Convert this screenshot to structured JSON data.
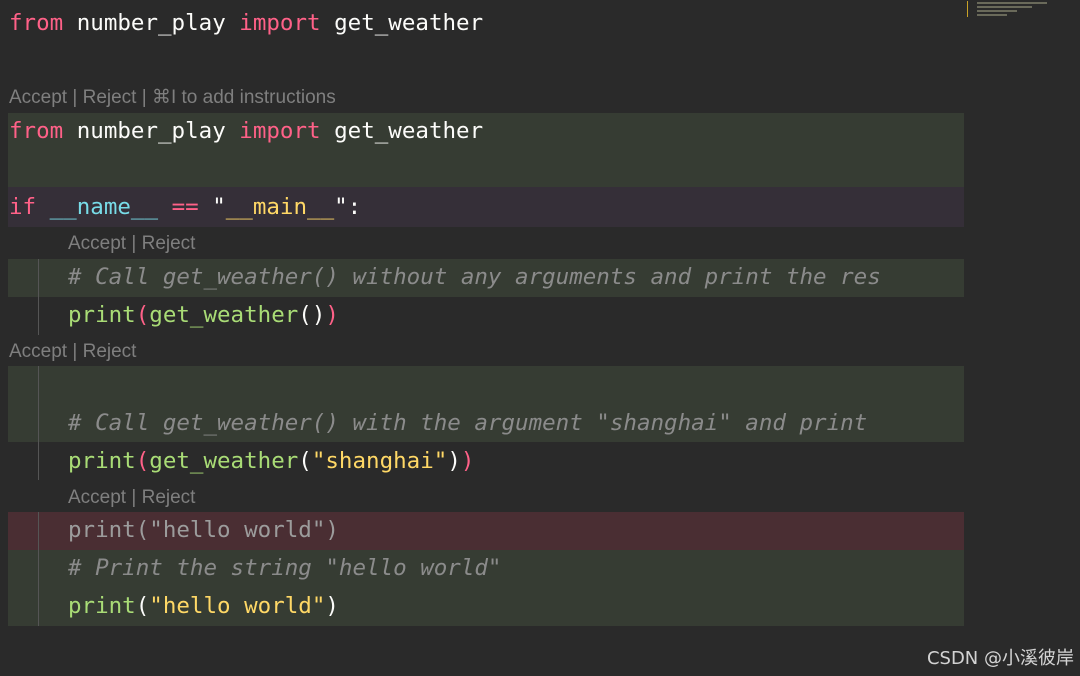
{
  "editor": {
    "line1": {
      "from": "from",
      "module": "number_play",
      "import": "import",
      "name": "get_weather"
    },
    "edit_prompt": {
      "accept": "Accept",
      "sep1": " | ",
      "reject": "Reject",
      "sep2": " | ",
      "instructions": "⌘I to add instructions"
    },
    "line2": {
      "from": "from",
      "module": "number_play",
      "import": "import",
      "name": "get_weather"
    },
    "line_if": {
      "if": "if",
      "dunder": "__name__",
      "eq": "==",
      "quote_open": "\"",
      "main": "__main__",
      "quote_close": "\"",
      "colon": ":"
    },
    "hunk1_prompt": {
      "accept": "Accept",
      "sep": " | ",
      "reject": "Reject"
    },
    "hunk1_comment": "# Call get_weather() without any arguments and print the res",
    "hunk1_print": {
      "print": "print",
      "open": "(",
      "fn": "get_weather",
      "args": "()",
      "close": ")"
    },
    "hunk2_prompt": {
      "accept": "Accept",
      "sep": " | ",
      "reject": "Reject"
    },
    "hunk2_comment": "# Call get_weather() with the argument \"shanghai\" and print",
    "hunk2_print": {
      "print": "print",
      "open": "(",
      "fn": "get_weather",
      "open2": "(",
      "str": "\"shanghai\"",
      "close2": ")",
      "close": ")"
    },
    "hunk3_prompt": {
      "accept": "Accept",
      "sep": " | ",
      "reject": "Reject"
    },
    "hunk3_removed": "print(\"hello world\")",
    "hunk3_comment": "# Print the string \"hello world\"",
    "hunk3_print": {
      "print": "print",
      "open": "(",
      "str": "\"hello world\"",
      "close": ")"
    }
  },
  "watermark": "CSDN @小溪彼岸",
  "colors": {
    "background": "#2a2a2a",
    "added_band": "#363c33",
    "modified_band": "#352f38",
    "removed_band": "#4a2e33",
    "keyword": "#ff6188",
    "function": "#a9dc76",
    "string": "#ffd866",
    "dunder": "#78dce8",
    "comment": "#8b8b8b"
  }
}
